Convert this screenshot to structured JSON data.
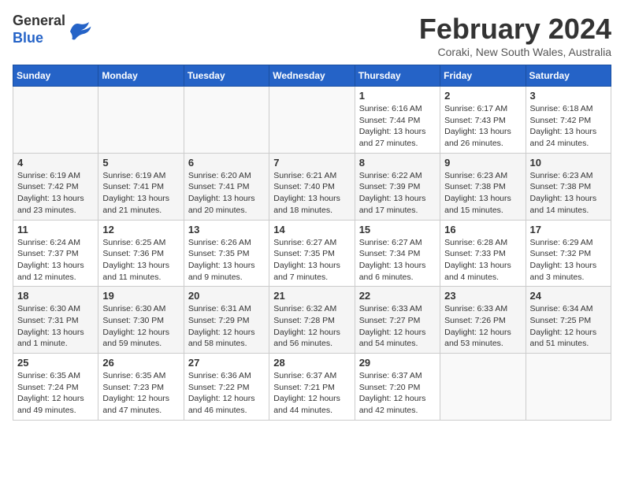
{
  "header": {
    "logo_line1": "General",
    "logo_line2": "Blue",
    "month_title": "February 2024",
    "location": "Coraki, New South Wales, Australia"
  },
  "weekdays": [
    "Sunday",
    "Monday",
    "Tuesday",
    "Wednesday",
    "Thursday",
    "Friday",
    "Saturday"
  ],
  "weeks": [
    [
      {
        "day": "",
        "info": ""
      },
      {
        "day": "",
        "info": ""
      },
      {
        "day": "",
        "info": ""
      },
      {
        "day": "",
        "info": ""
      },
      {
        "day": "1",
        "info": "Sunrise: 6:16 AM\nSunset: 7:44 PM\nDaylight: 13 hours\nand 27 minutes."
      },
      {
        "day": "2",
        "info": "Sunrise: 6:17 AM\nSunset: 7:43 PM\nDaylight: 13 hours\nand 26 minutes."
      },
      {
        "day": "3",
        "info": "Sunrise: 6:18 AM\nSunset: 7:42 PM\nDaylight: 13 hours\nand 24 minutes."
      }
    ],
    [
      {
        "day": "4",
        "info": "Sunrise: 6:19 AM\nSunset: 7:42 PM\nDaylight: 13 hours\nand 23 minutes."
      },
      {
        "day": "5",
        "info": "Sunrise: 6:19 AM\nSunset: 7:41 PM\nDaylight: 13 hours\nand 21 minutes."
      },
      {
        "day": "6",
        "info": "Sunrise: 6:20 AM\nSunset: 7:41 PM\nDaylight: 13 hours\nand 20 minutes."
      },
      {
        "day": "7",
        "info": "Sunrise: 6:21 AM\nSunset: 7:40 PM\nDaylight: 13 hours\nand 18 minutes."
      },
      {
        "day": "8",
        "info": "Sunrise: 6:22 AM\nSunset: 7:39 PM\nDaylight: 13 hours\nand 17 minutes."
      },
      {
        "day": "9",
        "info": "Sunrise: 6:23 AM\nSunset: 7:38 PM\nDaylight: 13 hours\nand 15 minutes."
      },
      {
        "day": "10",
        "info": "Sunrise: 6:23 AM\nSunset: 7:38 PM\nDaylight: 13 hours\nand 14 minutes."
      }
    ],
    [
      {
        "day": "11",
        "info": "Sunrise: 6:24 AM\nSunset: 7:37 PM\nDaylight: 13 hours\nand 12 minutes."
      },
      {
        "day": "12",
        "info": "Sunrise: 6:25 AM\nSunset: 7:36 PM\nDaylight: 13 hours\nand 11 minutes."
      },
      {
        "day": "13",
        "info": "Sunrise: 6:26 AM\nSunset: 7:35 PM\nDaylight: 13 hours\nand 9 minutes."
      },
      {
        "day": "14",
        "info": "Sunrise: 6:27 AM\nSunset: 7:35 PM\nDaylight: 13 hours\nand 7 minutes."
      },
      {
        "day": "15",
        "info": "Sunrise: 6:27 AM\nSunset: 7:34 PM\nDaylight: 13 hours\nand 6 minutes."
      },
      {
        "day": "16",
        "info": "Sunrise: 6:28 AM\nSunset: 7:33 PM\nDaylight: 13 hours\nand 4 minutes."
      },
      {
        "day": "17",
        "info": "Sunrise: 6:29 AM\nSunset: 7:32 PM\nDaylight: 13 hours\nand 3 minutes."
      }
    ],
    [
      {
        "day": "18",
        "info": "Sunrise: 6:30 AM\nSunset: 7:31 PM\nDaylight: 13 hours\nand 1 minute."
      },
      {
        "day": "19",
        "info": "Sunrise: 6:30 AM\nSunset: 7:30 PM\nDaylight: 12 hours\nand 59 minutes."
      },
      {
        "day": "20",
        "info": "Sunrise: 6:31 AM\nSunset: 7:29 PM\nDaylight: 12 hours\nand 58 minutes."
      },
      {
        "day": "21",
        "info": "Sunrise: 6:32 AM\nSunset: 7:28 PM\nDaylight: 12 hours\nand 56 minutes."
      },
      {
        "day": "22",
        "info": "Sunrise: 6:33 AM\nSunset: 7:27 PM\nDaylight: 12 hours\nand 54 minutes."
      },
      {
        "day": "23",
        "info": "Sunrise: 6:33 AM\nSunset: 7:26 PM\nDaylight: 12 hours\nand 53 minutes."
      },
      {
        "day": "24",
        "info": "Sunrise: 6:34 AM\nSunset: 7:25 PM\nDaylight: 12 hours\nand 51 minutes."
      }
    ],
    [
      {
        "day": "25",
        "info": "Sunrise: 6:35 AM\nSunset: 7:24 PM\nDaylight: 12 hours\nand 49 minutes."
      },
      {
        "day": "26",
        "info": "Sunrise: 6:35 AM\nSunset: 7:23 PM\nDaylight: 12 hours\nand 47 minutes."
      },
      {
        "day": "27",
        "info": "Sunrise: 6:36 AM\nSunset: 7:22 PM\nDaylight: 12 hours\nand 46 minutes."
      },
      {
        "day": "28",
        "info": "Sunrise: 6:37 AM\nSunset: 7:21 PM\nDaylight: 12 hours\nand 44 minutes."
      },
      {
        "day": "29",
        "info": "Sunrise: 6:37 AM\nSunset: 7:20 PM\nDaylight: 12 hours\nand 42 minutes."
      },
      {
        "day": "",
        "info": ""
      },
      {
        "day": "",
        "info": ""
      }
    ]
  ]
}
